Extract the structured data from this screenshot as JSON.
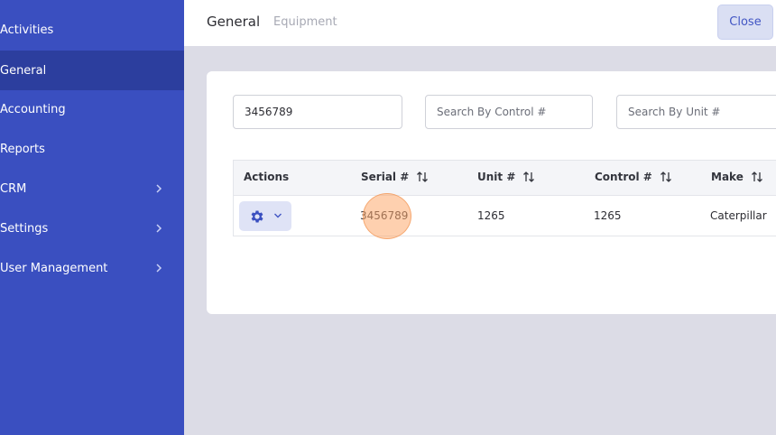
{
  "sidebar": {
    "items": [
      {
        "label": "Activities",
        "has_submenu": false
      },
      {
        "label": "General",
        "has_submenu": false,
        "active": true
      },
      {
        "label": "Accounting",
        "has_submenu": false
      },
      {
        "label": "Reports",
        "has_submenu": false
      },
      {
        "label": "CRM",
        "has_submenu": true
      },
      {
        "label": "Settings",
        "has_submenu": true
      },
      {
        "label": "User Management",
        "has_submenu": true
      }
    ]
  },
  "header": {
    "breadcrumb": [
      "General",
      "Equipment"
    ],
    "close_label": "Close"
  },
  "search": {
    "serial_value": "3456789",
    "control_placeholder": "Search By Control #",
    "unit_placeholder": "Search By Unit #"
  },
  "table": {
    "columns": [
      "Actions",
      "Serial #",
      "Unit #",
      "Control #",
      "Make"
    ],
    "rows": [
      {
        "serial": "3456789",
        "unit": "1265",
        "control": "1265",
        "make": "Caterpillar"
      }
    ]
  },
  "colors": {
    "sidebar_bg": "#3a4fc0",
    "sidebar_active": "#2c3e9e",
    "accent": "#4256c4",
    "click_marker": "#fdaa6e"
  }
}
